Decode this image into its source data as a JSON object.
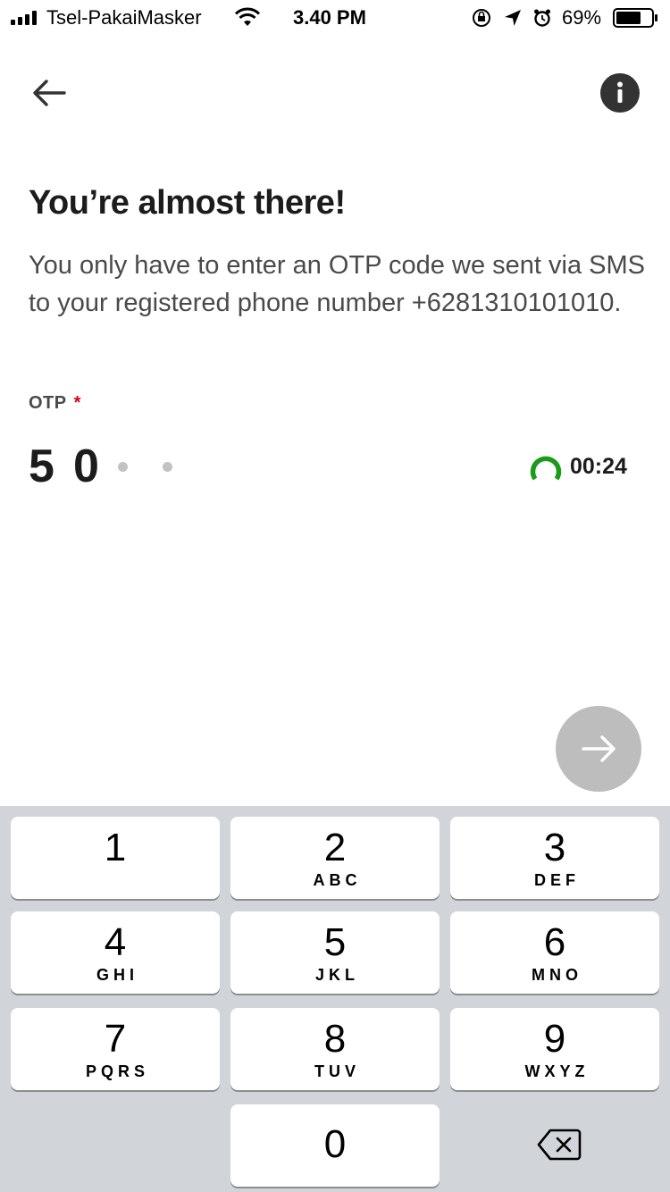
{
  "status_bar": {
    "carrier": "Tsel-PakaiMasker",
    "time": "3.40 PM",
    "battery_percent": "69%",
    "battery_level": 0.69,
    "signal_bars": 4,
    "icons": [
      "wifi-icon",
      "orientation-lock-icon",
      "location-arrow-icon",
      "alarm-icon",
      "battery-icon"
    ]
  },
  "header": {
    "back_icon": "arrow-left-icon",
    "info_icon": "info-icon"
  },
  "content": {
    "title": "You’re almost there!",
    "description": "You only have to enter an OTP code we sent via SMS to your registered phone number +6281310101010.",
    "otp_label": "OTP",
    "otp_required_mark": "*",
    "otp_digits": [
      "5",
      "0"
    ],
    "otp_remaining_slots": 2,
    "timer_text": "00:24",
    "timer_color": "#1a9c1a",
    "next_icon": "arrow-right-icon",
    "next_button_color": "#bdbdbd"
  },
  "keypad": {
    "keys": [
      {
        "num": "1",
        "letters": ""
      },
      {
        "num": "2",
        "letters": "ABC"
      },
      {
        "num": "3",
        "letters": "DEF"
      },
      {
        "num": "4",
        "letters": "GHI"
      },
      {
        "num": "5",
        "letters": "JKL"
      },
      {
        "num": "6",
        "letters": "MNO"
      },
      {
        "num": "7",
        "letters": "PQRS"
      },
      {
        "num": "8",
        "letters": "TUV"
      },
      {
        "num": "9",
        "letters": "WXYZ"
      },
      {
        "num": "0",
        "letters": ""
      }
    ],
    "delete_icon": "backspace-icon"
  }
}
